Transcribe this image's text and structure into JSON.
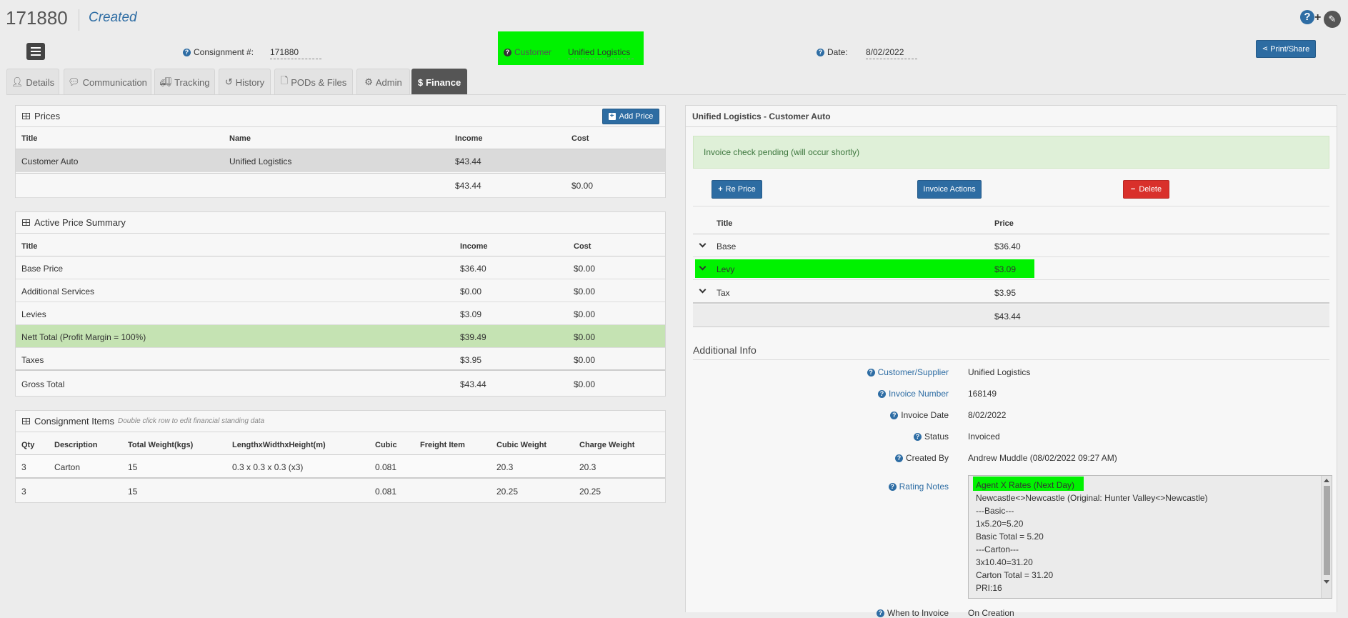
{
  "header": {
    "consignment_id": "171880",
    "status": "Created",
    "consignment_label": "Consignment #:",
    "consignment_value": "171880",
    "customer_label": "Customer",
    "customer_value": "Unified Logistics",
    "date_label": "Date:",
    "date_value": "8/02/2022",
    "print_label": "Print/Share",
    "help_plus": "+"
  },
  "tabs": [
    {
      "label": "Details",
      "icon": "user-icon"
    },
    {
      "label": "Communication",
      "icon": "comment-icon"
    },
    {
      "label": "Tracking",
      "icon": "truck-icon"
    },
    {
      "label": "History",
      "icon": "history-icon"
    },
    {
      "label": "PODs & Files",
      "icon": "file-icon"
    },
    {
      "label": "Admin",
      "icon": "gear-icon"
    },
    {
      "label": "Finance",
      "icon": "dollar-icon",
      "active": true
    }
  ],
  "prices": {
    "title": "Prices",
    "add_label": "Add Price",
    "headers": [
      "Title",
      "Name",
      "Income",
      "Cost"
    ],
    "rows": [
      {
        "title": "Customer Auto",
        "name": "Unified Logistics",
        "income": "$43.44",
        "cost": ""
      }
    ],
    "total": {
      "income": "$43.44",
      "cost": "$0.00"
    }
  },
  "summary": {
    "title": "Active Price Summary",
    "headers": [
      "Title",
      "Income",
      "Cost"
    ],
    "rows": [
      {
        "title": "Base Price",
        "income": "$36.40",
        "cost": "$0.00"
      },
      {
        "title": "Additional Services",
        "income": "$0.00",
        "cost": "$0.00"
      },
      {
        "title": "Levies",
        "income": "$3.09",
        "cost": "$0.00"
      },
      {
        "title": "Nett Total (Profit Margin = 100%)",
        "income": "$39.49",
        "cost": "$0.00"
      },
      {
        "title": "Taxes",
        "income": "$3.95",
        "cost": "$0.00"
      },
      {
        "title": "Gross Total",
        "income": "$43.44",
        "cost": "$0.00"
      }
    ]
  },
  "items": {
    "title": "Consignment Items",
    "hint": "Double click row to edit financial standing data",
    "headers": [
      "Qty",
      "Description",
      "Total Weight(kgs)",
      "LengthxWidthxHeight(m)",
      "Cubic",
      "Freight Item",
      "Cubic Weight",
      "Charge Weight"
    ],
    "rows": [
      [
        "3",
        "Carton",
        "15",
        "0.3 x 0.3 x 0.3 (x3)",
        "0.081",
        "",
        "20.3",
        "20.3"
      ],
      [
        "3",
        "",
        "15",
        "",
        "0.081",
        "",
        "20.25",
        "20.25"
      ]
    ]
  },
  "invoice": {
    "title": "Unified Logistics - Customer Auto",
    "alert": "Invoice check pending (will occur shortly)",
    "reprice_label": "Re Price",
    "actions_label": "Invoice Actions",
    "delete_label": "Delete",
    "headers": [
      "Title",
      "Price"
    ],
    "rows": [
      {
        "title": "Base",
        "price": "$36.40"
      },
      {
        "title": "Levy",
        "price": "$3.09"
      },
      {
        "title": "Tax",
        "price": "$3.95"
      }
    ],
    "total": "$43.44"
  },
  "additional": {
    "title": "Additional Info",
    "customer_label": "Customer/Supplier",
    "customer_value": "Unified Logistics",
    "invoice_number_label": "Invoice Number",
    "invoice_number_value": "168149",
    "invoice_date_label": "Invoice Date",
    "invoice_date_value": "8/02/2022",
    "status_label": "Status",
    "status_value": "Invoiced",
    "created_label": "Created By",
    "created_value": "Andrew Muddle (08/02/2022 09:27 AM)",
    "notes_label": "Rating Notes",
    "notes": [
      "Agent X Rates (Next Day)",
      "Newcastle<>Newcastle (Original: Hunter Valley<>Newcastle)",
      "---Basic---",
      "1x5.20=5.20",
      "Basic Total = 5.20",
      "---Carton---",
      "3x10.40=31.20",
      "Carton Total = 31.20",
      "PRI:16"
    ],
    "when_label": "When to Invoice",
    "when_value": "On Creation"
  },
  "colors": {
    "highlight_green": "#00f200",
    "nett_row": "#c5e3b3",
    "alert_bg": "#dff0d8",
    "primary": "#2d6ca2",
    "danger": "#d9302b"
  }
}
